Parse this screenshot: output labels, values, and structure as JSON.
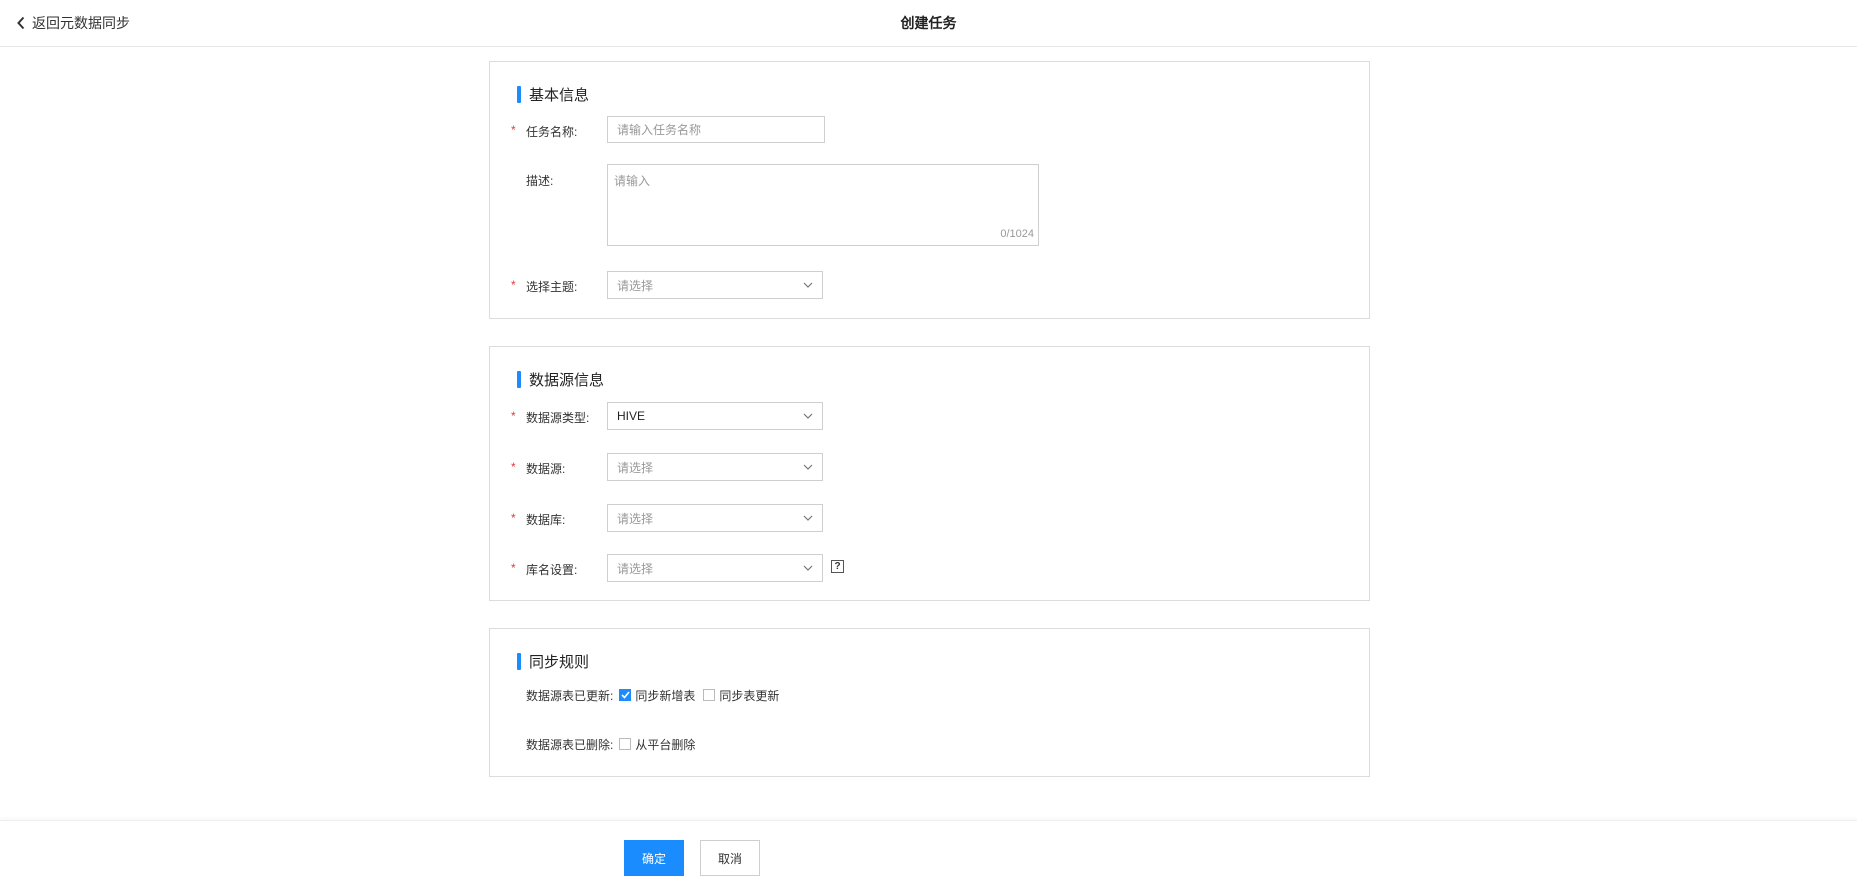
{
  "header": {
    "back_label": "返回元数据同步",
    "title": "创建任务"
  },
  "basic": {
    "section_title": "基本信息",
    "task_name_label": "任务名称:",
    "task_name_placeholder": "请输入任务名称",
    "desc_label": "描述:",
    "desc_placeholder": "请输入",
    "desc_counter": "0/1024",
    "topic_label": "选择主题:",
    "topic_value": "请选择"
  },
  "datasource": {
    "section_title": "数据源信息",
    "type_label": "数据源类型:",
    "type_value": "HIVE",
    "source_label": "数据源:",
    "source_value": "请选择",
    "db_label": "数据库:",
    "db_value": "请选择",
    "dbname_label": "库名设置:",
    "dbname_value": "请选择",
    "help_glyph": "?"
  },
  "sync": {
    "section_title": "同步规则",
    "updated_label": "数据源表已更新:",
    "opt_new_table": "同步新增表",
    "opt_new_table_checked": true,
    "opt_table_update": "同步表更新",
    "opt_table_update_checked": false,
    "deleted_label": "数据源表已删除:",
    "opt_delete": "从平台删除",
    "opt_delete_checked": false
  },
  "footer": {
    "confirm": "确定",
    "cancel": "取消"
  },
  "colors": {
    "accent": "#1a8cfe",
    "required": "#e4393c"
  }
}
